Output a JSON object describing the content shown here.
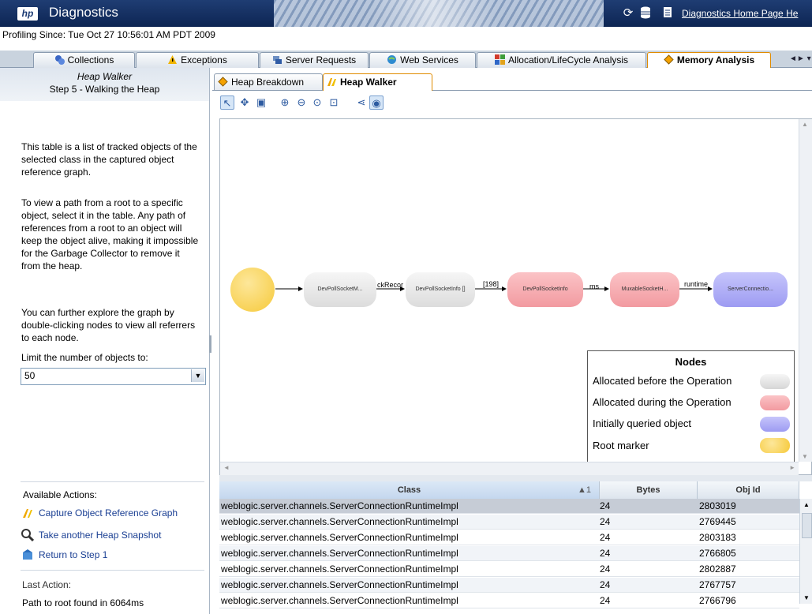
{
  "app": {
    "title": "Diagnostics",
    "logo": "hp",
    "home_link": "Diagnostics Home Page",
    "help_link": "He"
  },
  "header_icons": [
    "refresh-icon",
    "database-icon",
    "document-icon"
  ],
  "profiling": "Profiling Since: Tue Oct 27 10:56:01 AM PDT 2009",
  "main_tabs": [
    {
      "label": "Collections",
      "icon": "collections-icon"
    },
    {
      "label": "Exceptions",
      "icon": "warning-icon"
    },
    {
      "label": "Server Requests",
      "icon": "server-requests-icon"
    },
    {
      "label": "Web Services",
      "icon": "web-services-icon"
    },
    {
      "label": "Allocation/LifeCycle Analysis",
      "icon": "allocation-icon"
    },
    {
      "label": "Memory Analysis",
      "icon": "memory-icon",
      "selected": true
    }
  ],
  "tabs_nav": "◄► ▾",
  "left": {
    "heading": "Heap Walker",
    "step": "Step 5 - Walking the Heap",
    "para1": "This table is a list of tracked objects of the selected class in the captured object reference graph.",
    "para2": "To view a path from a root to a specific object, select it in the table. Any path of references from a root to an object will keep the object alive, making it impossible for the Garbage Collector to remove it from the heap.",
    "para3": "You can further explore the graph by double-clicking nodes to view all referrers to each node.",
    "limit_label": "Limit the number of objects to:",
    "limit_value": "50",
    "actions_label": "Available Actions:",
    "actions": [
      {
        "label": "Capture Object Reference Graph",
        "icon": "capture-graph-icon"
      },
      {
        "label": "Take another Heap Snapshot",
        "icon": "snapshot-icon"
      },
      {
        "label": "Return to Step 1",
        "icon": "return-icon"
      }
    ],
    "last_action_label": "Last Action:",
    "last_action_value": "Path to root found in 6064ms"
  },
  "sub_tabs": [
    {
      "label": "Heap Breakdown",
      "icon": "heap-breakdown-icon"
    },
    {
      "label": "Heap Walker",
      "icon": "heap-walker-icon",
      "selected": true
    }
  ],
  "toolbar": [
    "select-tool-icon",
    "pan-tool-icon",
    "fit-tool-icon",
    "zoom-in-icon",
    "zoom-out-icon",
    "zoom-region-icon",
    "zoom-fit-icon",
    "graph-layout-icon",
    "graph-overview-icon"
  ],
  "graph": {
    "nodes": [
      {
        "label": "",
        "type": "root"
      },
      {
        "label": "DevPollSocketM...",
        "type": "before"
      },
      {
        "label": "DevPollSocketInfo []",
        "type": "before"
      },
      {
        "label": "DevPollSocketInfo",
        "type": "during"
      },
      {
        "label": "MuxableSocketH...",
        "type": "during"
      },
      {
        "label": "ServerConnectio...",
        "type": "queried"
      }
    ],
    "edges": [
      "ckRecor",
      "[198]",
      "ms",
      "runtime"
    ]
  },
  "legend": {
    "title": "Nodes",
    "items": [
      {
        "label": "Allocated before the Operation",
        "color": "#e2e2e2"
      },
      {
        "label": "Allocated during the Operation",
        "color": "#f6a9ad"
      },
      {
        "label": "Initially queried object",
        "color": "#a9a9f6"
      },
      {
        "label": "Root marker",
        "color": "#f8d44e"
      }
    ]
  },
  "colors": {
    "header": "#1f3d73",
    "before_node": "#e4e4e4",
    "during_node": "#f5a7ac",
    "queried_node": "#a9a8f5",
    "root_node": "#f9d556",
    "selected_tab_border": "#e08b00"
  },
  "table": {
    "columns": [
      "Class",
      "Bytes",
      "Obj Id"
    ],
    "sort_indicator": "▲1",
    "rows": [
      [
        "weblogic.server.channels.ServerConnectionRuntimeImpl",
        "24",
        "2803019"
      ],
      [
        "weblogic.server.channels.ServerConnectionRuntimeImpl",
        "24",
        "2769445"
      ],
      [
        "weblogic.server.channels.ServerConnectionRuntimeImpl",
        "24",
        "2803183"
      ],
      [
        "weblogic.server.channels.ServerConnectionRuntimeImpl",
        "24",
        "2766805"
      ],
      [
        "weblogic.server.channels.ServerConnectionRuntimeImpl",
        "24",
        "2802887"
      ],
      [
        "weblogic.server.channels.ServerConnectionRuntimeImpl",
        "24",
        "2767757"
      ],
      [
        "weblogic.server.channels.ServerConnectionRuntimeImpl",
        "24",
        "2766796"
      ]
    ]
  }
}
